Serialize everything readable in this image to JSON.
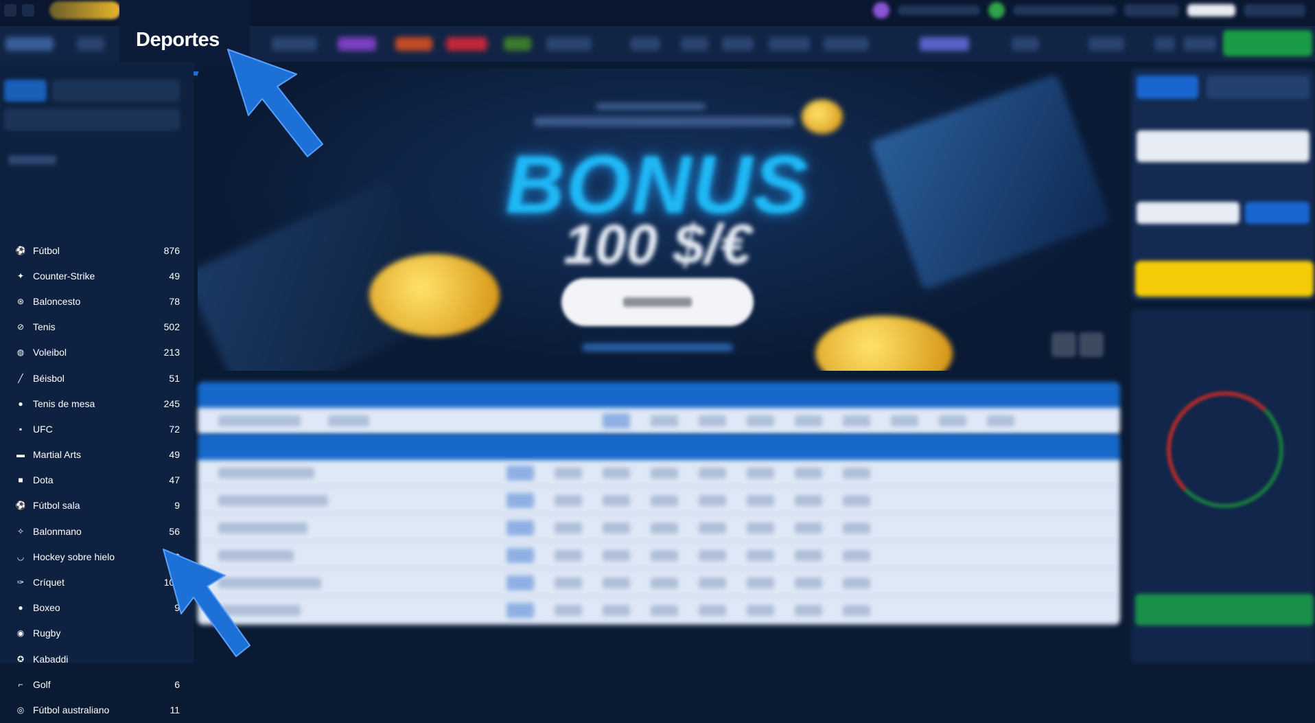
{
  "nav": {
    "active_tab": "Deportes"
  },
  "sidebar": {
    "sports": [
      {
        "name": "Fútbol",
        "count": "876",
        "icon": "soccer-ball-icon"
      },
      {
        "name": "Counter-Strike",
        "count": "49",
        "icon": "counter-strike-icon"
      },
      {
        "name": "Baloncesto",
        "count": "78",
        "icon": "basketball-icon"
      },
      {
        "name": "Tenis",
        "count": "502",
        "icon": "tennis-icon"
      },
      {
        "name": "Voleibol",
        "count": "213",
        "icon": "volleyball-icon"
      },
      {
        "name": "Béisbol",
        "count": "51",
        "icon": "baseball-icon"
      },
      {
        "name": "Tenis de mesa",
        "count": "245",
        "icon": "table-tennis-icon"
      },
      {
        "name": "UFC",
        "count": "72",
        "icon": "ufc-icon"
      },
      {
        "name": "Martial Arts",
        "count": "49",
        "icon": "martial-arts-icon"
      },
      {
        "name": "Dota",
        "count": "47",
        "icon": "dota-icon"
      },
      {
        "name": "Fútbol sala",
        "count": "9",
        "icon": "futsal-icon"
      },
      {
        "name": "Balonmano",
        "count": "56",
        "icon": "handball-icon"
      },
      {
        "name": "Hockey sobre hielo",
        "count": "32",
        "icon": "ice-hockey-icon"
      },
      {
        "name": "Críquet",
        "count": "104",
        "icon": "cricket-icon"
      },
      {
        "name": "Boxeo",
        "count": "9",
        "icon": "boxing-glove-icon"
      },
      {
        "name": "Rugby",
        "count": "",
        "icon": "rugby-ball-icon"
      },
      {
        "name": "Kabaddi",
        "count": "",
        "icon": "kabaddi-icon"
      },
      {
        "name": "Golf",
        "count": "6",
        "icon": "golf-icon"
      },
      {
        "name": "Fútbol australiano",
        "count": "11",
        "icon": "australian-football-icon"
      }
    ]
  },
  "banner": {
    "headline": "BONUS",
    "amount": "100 $/€"
  },
  "colors": {
    "accent_blue": "#1e6fd9",
    "arrow_blue": "#1d70d6",
    "cta_green": "#1a9b46",
    "cta_yellow": "#f5cc0a"
  }
}
